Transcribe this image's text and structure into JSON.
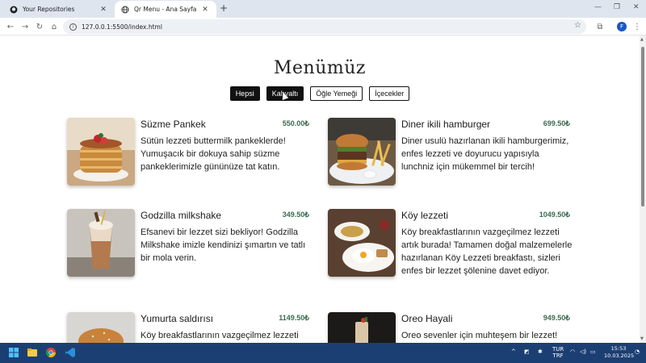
{
  "browser": {
    "tabs": [
      {
        "title": "Your Repositories",
        "icon": "github-icon",
        "active": false
      },
      {
        "title": "Qr Menu - Ana Sayfa",
        "icon": "globe-icon",
        "active": true
      }
    ],
    "url": "127.0.0.1:5500/index.html",
    "profile_initial": "F"
  },
  "page": {
    "title": "Menümüz",
    "filters": [
      {
        "label": "Hepsi",
        "style": "dark"
      },
      {
        "label": "Kahvaltı",
        "style": "dark"
      },
      {
        "label": "Öğle Yemeği",
        "style": "light"
      },
      {
        "label": "İçecekler",
        "style": "light"
      }
    ],
    "items": [
      {
        "name": "Süzme Pankek",
        "price": "550.00₺",
        "desc": "Sütün lezzeti buttermilk pankeklerde! Yumuşacık bir dokuya sahip süzme pankeklerimizle gününüze tat katın.",
        "image": "pancakes"
      },
      {
        "name": "Diner ikili hamburger",
        "price": "699.50₺",
        "desc": "Diner usulü hazırlanan ikili hamburgerimiz, enfes lezzeti ve doyurucu yapısıyla lunchniz için mükemmel bir tercih!",
        "image": "burger-fries"
      },
      {
        "name": "Godzilla milkshake",
        "price": "349.50₺",
        "desc": "Efsanevi bir lezzet sizi bekliyor! Godzilla Milkshake imizle kendinizi şımartın ve tatlı bir mola verin.",
        "image": "milkshake"
      },
      {
        "name": "Köy lezzeti",
        "price": "1049.50₺",
        "desc": "Köy breakfastlarının vazgeçilmez lezzeti artık burada! Tamamen doğal malzemelerle hazırlanan Köy Lezzeti breakfastı, sizleri enfes bir lezzet şölenine davet ediyor.",
        "image": "breakfast-plate"
      },
      {
        "name": "Yumurta saldırısı",
        "price": "1149.50₺",
        "desc": "Köy breakfastlarının vazgeçilmez lezzeti",
        "image": "egg-burger"
      },
      {
        "name": "Oreo Hayali",
        "price": "949.50₺",
        "desc": "Oreo sevenler için muhteşem bir lezzet!",
        "image": "oreo-drink"
      }
    ]
  },
  "taskbar": {
    "lang_top": "TUR",
    "lang_bottom": "TRF",
    "time": "15:53",
    "date": "10.03.2025"
  },
  "colors": {
    "price": "#3b6b4f",
    "tabstrip": "#dfe5ee",
    "taskbar": "#1c3f73"
  }
}
